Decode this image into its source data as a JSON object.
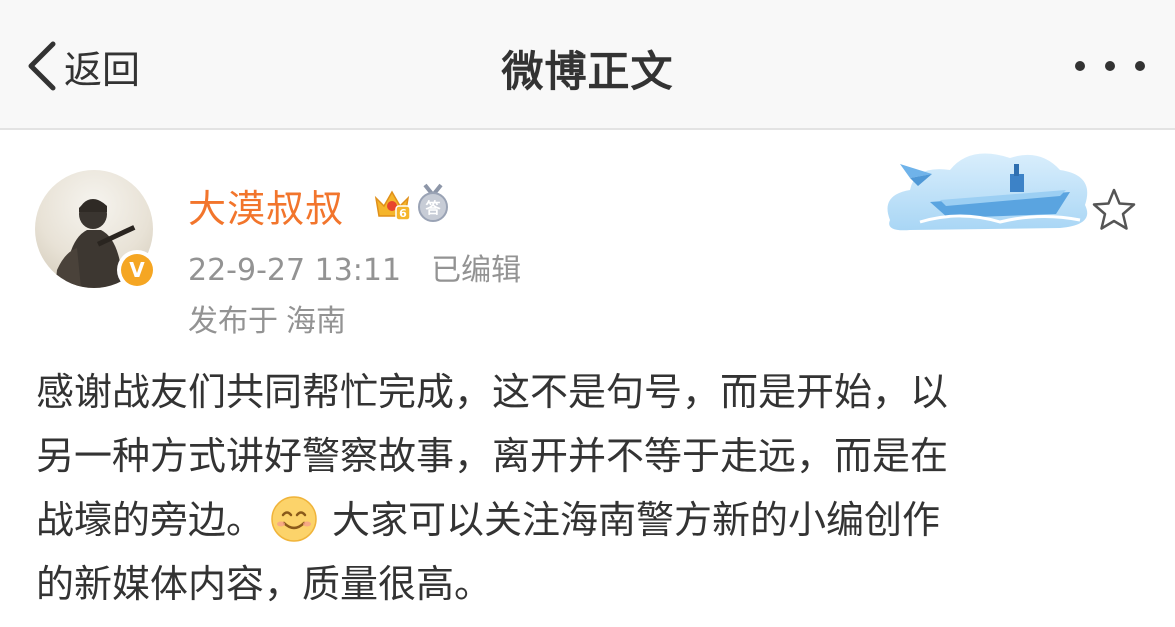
{
  "navbar": {
    "back_label": "返回",
    "title": "微博正文",
    "more_icon": "more-dots-icon"
  },
  "post": {
    "author": {
      "name": "大漠叔叔",
      "verified_badge_letter": "V",
      "member_level": "6",
      "medal_label": "答"
    },
    "timestamp": "22-9-27 13:11",
    "edited_label": "已编辑",
    "location_prefix": "发布于",
    "location": "海南",
    "body_lines": [
      "感谢战友们共同帮忙完成，这不是句号，而是开始，以",
      "另一种方式讲好警察故事，离开并不等于走远，而是在",
      "战壕的旁边。",
      "大家可以关注海南警方新的小编创作",
      "的新媒体内容，质量很高。"
    ],
    "emoji": "smile-emoji"
  },
  "colors": {
    "username": "#f2752c",
    "meta": "#939393",
    "text": "#333333",
    "navbar_bg": "#f8f8f8",
    "verify_badge": "#f5a623"
  }
}
